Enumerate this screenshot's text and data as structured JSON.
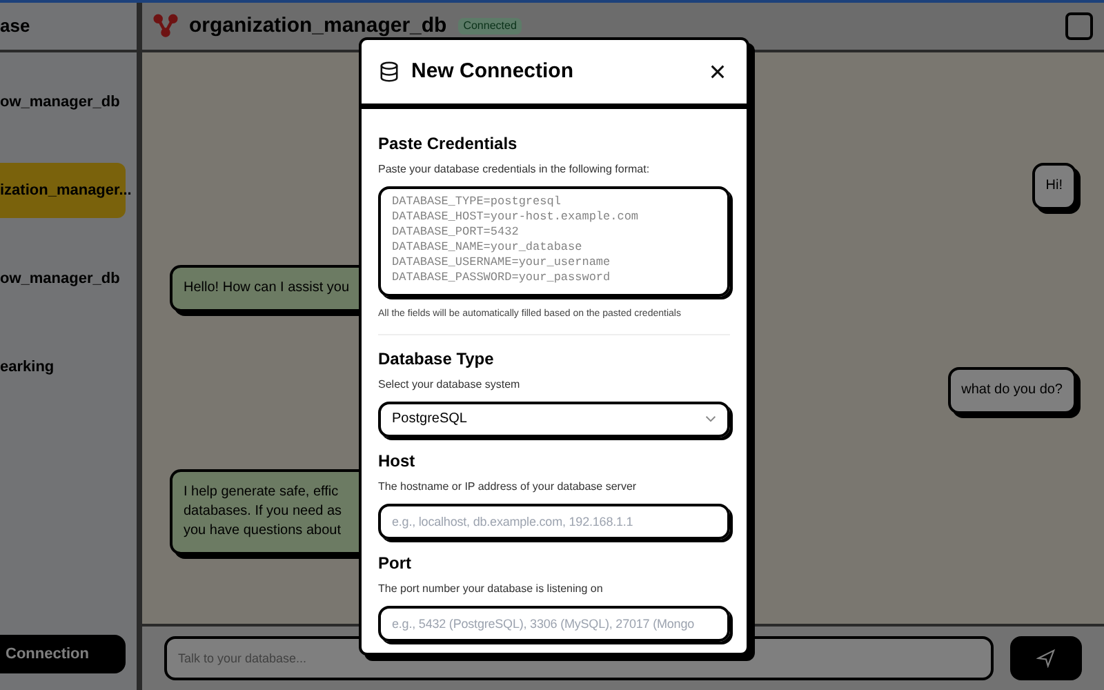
{
  "sidebar": {
    "title": "ase",
    "items": [
      {
        "name": "ow_manager_db",
        "selected": false
      },
      {
        "name": "ization_manager...",
        "selected": true
      },
      {
        "name": "ow_manager_db",
        "selected": false
      },
      {
        "name": "earking",
        "selected": false
      }
    ],
    "new_button": "Connection"
  },
  "chat": {
    "title": "organization_manager_db",
    "status": "Connected",
    "messages": [
      {
        "kind": "sent",
        "lines": [
          "Hi!"
        ]
      },
      {
        "kind": "received",
        "lines": [
          "Hello! How can I assist you"
        ]
      },
      {
        "kind": "sent",
        "lines": [
          "what do you do?"
        ]
      },
      {
        "kind": "received",
        "lines": [
          "I help generate safe, effic",
          "databases. If you need as",
          "you have questions about"
        ]
      }
    ],
    "input_placeholder": "Talk to your database..."
  },
  "modal": {
    "title": "New Connection",
    "sections": [
      {
        "kind": "textarea",
        "heading": "Paste Credentials",
        "description": "Paste your database credentials in the following format:",
        "placeholder": "DATABASE_TYPE=postgresql\nDATABASE_HOST=your-host.example.com\nDATABASE_PORT=5432\nDATABASE_NAME=your_database\nDATABASE_USERNAME=your_username\nDATABASE_PASSWORD=your_password",
        "note": "All the fields will be automatically filled based on the pasted credentials"
      },
      {
        "kind": "select",
        "heading": "Database Type",
        "description": "Select your database system",
        "value": "PostgreSQL"
      },
      {
        "kind": "input",
        "heading": "Host",
        "description": "The hostname or IP address of your database server",
        "placeholder": "e.g., localhost, db.example.com, 192.168.1.1"
      },
      {
        "kind": "input",
        "heading": "Port",
        "description": "The port number your database is listening on",
        "placeholder": "e.g., 5432 (PostgreSQL), 3306 (MySQL), 27017 (Mongo"
      }
    ]
  }
}
